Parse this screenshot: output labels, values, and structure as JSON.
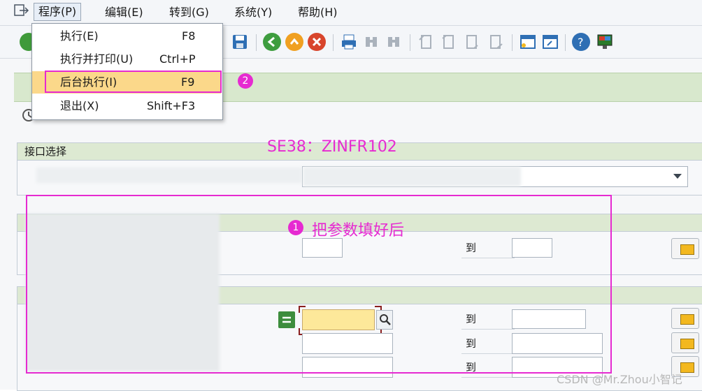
{
  "menubar": {
    "items": [
      {
        "label": "程序(P)"
      },
      {
        "label": "编辑(E)"
      },
      {
        "label": "转到(G)"
      },
      {
        "label": "系统(Y)"
      },
      {
        "label": "帮助(H)"
      }
    ]
  },
  "program_menu": {
    "items": [
      {
        "label": "执行(E)",
        "shortcut": "F8"
      },
      {
        "label": "执行并打印(U)",
        "shortcut": "Ctrl+P"
      },
      {
        "label": "后台执行(I)",
        "shortcut": "F9"
      },
      {
        "label": "退出(X)",
        "shortcut": "Shift+F3"
      }
    ]
  },
  "annotations": {
    "program_name": "SE38：ZINFR102",
    "step1_badge": "1",
    "step1_text": "把参数填好后",
    "step2_badge": "2"
  },
  "interface_block": {
    "title": "接口选择"
  },
  "ranges": {
    "to_label": "到"
  },
  "watermark": "CSDN @Mr.Zhou小智记",
  "colors": {
    "accent_magenta": "#e62ad1",
    "highlight": "#fbd88a",
    "required_field": "#fde89a",
    "section_header": "#dde9d2"
  }
}
